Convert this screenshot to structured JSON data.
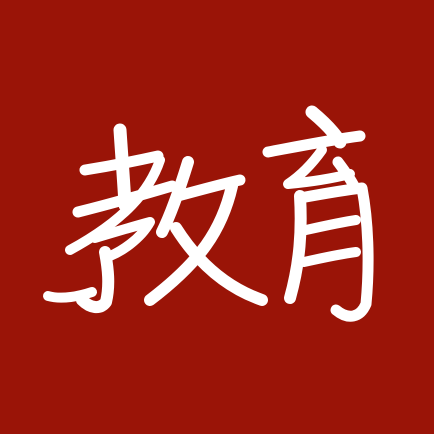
{
  "logo": {
    "text": "教育",
    "background_color": "#9a1407",
    "glyph_color": "#ffffff"
  }
}
